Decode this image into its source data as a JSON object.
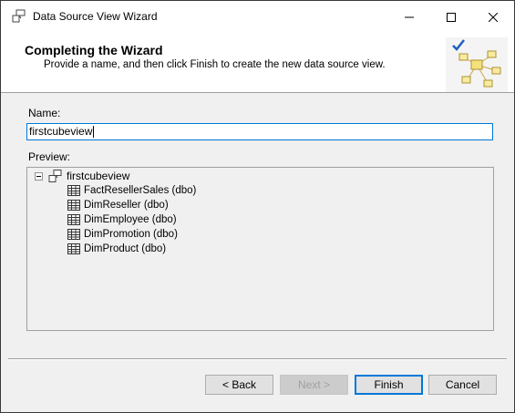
{
  "window": {
    "title": "Data Source View Wizard",
    "controls": {
      "minimize": "minimize",
      "maximize": "maximize",
      "close": "close"
    }
  },
  "banner": {
    "heading": "Completing the Wizard",
    "subheading": "Provide a name, and then click Finish to create the new data source view."
  },
  "form": {
    "name_label": "Name:",
    "name_value": "firstcubeview",
    "preview_label": "Preview:"
  },
  "preview": {
    "root": "firstcubeview",
    "tables": [
      "FactResellerSales (dbo)",
      "DimReseller (dbo)",
      "DimEmployee (dbo)",
      "DimPromotion (dbo)",
      "DimProduct (dbo)"
    ]
  },
  "buttons": {
    "back": "< Back",
    "next": "Next >",
    "finish": "Finish",
    "cancel": "Cancel"
  },
  "colors": {
    "accent": "#0078d7",
    "disabled_text": "#a0a0a0"
  }
}
